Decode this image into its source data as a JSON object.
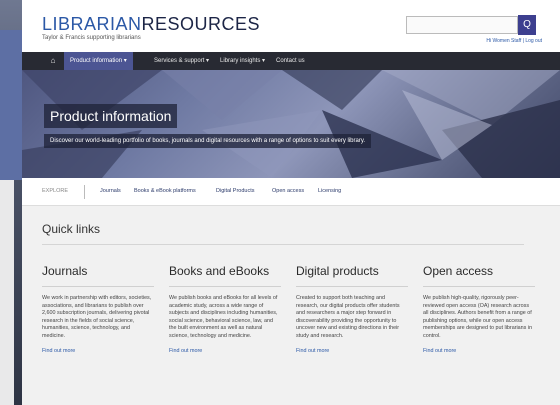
{
  "header": {
    "logo_part1": "LIBRARIAN",
    "logo_part2": "RESOURCES",
    "tagline": "Taylor & Francis supporting librarians",
    "search_button": "Q",
    "user_links": "Hi Women Staff | Log out"
  },
  "nav": {
    "home": "⌂",
    "items": [
      "Product information ▾",
      "Services & support ▾",
      "Library insights ▾",
      "Contact us"
    ]
  },
  "hero": {
    "title": "Product information",
    "subtitle": "Discover our world-leading portfolio of books, journals and digital resources with a range of options to suit every library."
  },
  "explore": {
    "label": "EXPLORE",
    "links": [
      "Journals",
      "Books & eBook platforms",
      "Digital Products",
      "Open access",
      "Licensing"
    ]
  },
  "quick_links": {
    "title": "Quick links",
    "columns": [
      {
        "heading": "Journals",
        "body": "We work in partnership with editors, societies, associations, and librarians to publish over 2,600 subscription journals, delivering pivotal research in the fields of social science, humanities, science, technology, and medicine.",
        "link": "Find out more"
      },
      {
        "heading": "Books and eBooks",
        "body": "We publish books and eBooks for all levels of academic study, across a wide range of subjects and disciplines including humanities, social science, behavioral science, law, and the built environment as well as natural science, technology and medicine.",
        "link": "Find out more"
      },
      {
        "heading": "Digital products",
        "body": "Created to support both teaching and research, our digital products offer students and researchers a major step forward in discoverability providing the opportunity to uncover new and existing directions in their study and research.",
        "link": "Find out more"
      },
      {
        "heading": "Open access",
        "body": "We publish high-quality, rigorously peer-reviewed open access (OA) research across all disciplines. Authors benefit from a range of publishing options, while our open access memberships are designed to put librarians in control.",
        "link": "Find out more"
      }
    ]
  },
  "colors": {
    "nav_bg": "#282a33",
    "nav_active": "#4c5593",
    "link": "#2b58a6",
    "page_bg": "#f1f1f1"
  }
}
